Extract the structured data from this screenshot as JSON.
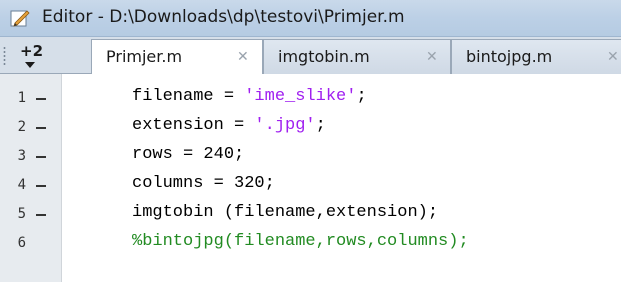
{
  "window": {
    "title": "Editor - D:\\Downloads\\dp\\testovi\\Primjer.m",
    "icon": "editor-pencil-icon"
  },
  "tabs": {
    "overflow_count": "+2",
    "items": [
      {
        "label": "Primjer.m",
        "active": true
      },
      {
        "label": "imgtobin.m",
        "active": false
      },
      {
        "label": "bintojpg.m",
        "active": false
      }
    ],
    "close_glyph": "✕"
  },
  "editor": {
    "lines": [
      {
        "number": "1",
        "marker": "—",
        "pre": "filename = ",
        "str": "'ime_slike'",
        "post": ";",
        "comment": ""
      },
      {
        "number": "2",
        "marker": "—",
        "pre": "extension = ",
        "str": "'.jpg'",
        "post": ";",
        "comment": ""
      },
      {
        "number": "3",
        "marker": "—",
        "pre": "rows = 240;",
        "str": "",
        "post": "",
        "comment": ""
      },
      {
        "number": "4",
        "marker": "—",
        "pre": "columns = 320;",
        "str": "",
        "post": "",
        "comment": ""
      },
      {
        "number": "5",
        "marker": "—",
        "pre": "imgtobin (filename,extension);",
        "str": "",
        "post": "",
        "comment": ""
      },
      {
        "number": "6",
        "marker": "",
        "pre": "",
        "str": "",
        "post": "",
        "comment": "%bintojpg(filename,rows,columns);"
      }
    ],
    "colors": {
      "string": "#a020f0",
      "comment": "#228b22",
      "keyword": "#000000"
    }
  }
}
